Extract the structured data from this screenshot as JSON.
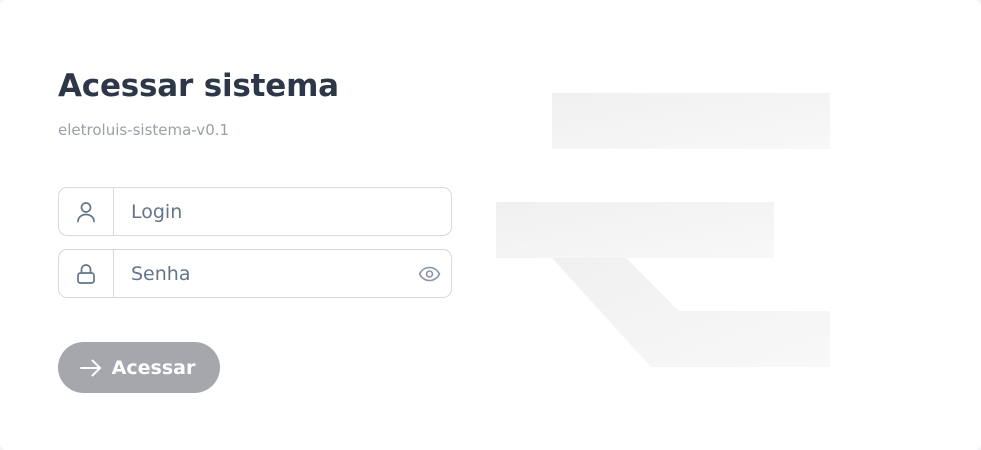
{
  "login": {
    "title": "Acessar sistema",
    "subtitle": "eletroluis-sistema-v0.1",
    "fields": {
      "login": {
        "placeholder": "Login",
        "value": "",
        "icon": "user-icon"
      },
      "password": {
        "placeholder": "Senha",
        "value": "",
        "icon": "lock-icon",
        "toggle_icon": "eye-icon"
      }
    },
    "submit": {
      "label": "Acessar",
      "icon": "arrow-right-icon"
    }
  },
  "colors": {
    "title": "#2d3748",
    "subtitle": "#9aa0a8",
    "button_bg": "#a5a7ad",
    "border": "#d5d9e0",
    "icon": "#64748b",
    "watermark": "#f2f2f2"
  },
  "background_logo": {
    "icon": "brand-logo-watermark"
  }
}
